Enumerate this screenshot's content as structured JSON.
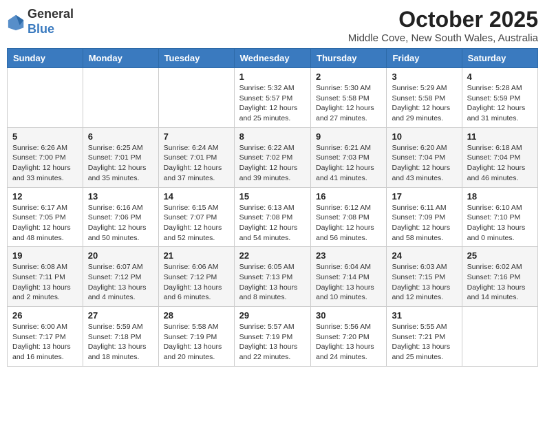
{
  "logo": {
    "general": "General",
    "blue": "Blue"
  },
  "title": "October 2025",
  "subtitle": "Middle Cove, New South Wales, Australia",
  "weekdays": [
    "Sunday",
    "Monday",
    "Tuesday",
    "Wednesday",
    "Thursday",
    "Friday",
    "Saturday"
  ],
  "weeks": [
    [
      null,
      null,
      null,
      {
        "day": 1,
        "sunrise": "5:32 AM",
        "sunset": "5:57 PM",
        "daylight": "12 hours and 25 minutes."
      },
      {
        "day": 2,
        "sunrise": "5:30 AM",
        "sunset": "5:58 PM",
        "daylight": "12 hours and 27 minutes."
      },
      {
        "day": 3,
        "sunrise": "5:29 AM",
        "sunset": "5:58 PM",
        "daylight": "12 hours and 29 minutes."
      },
      {
        "day": 4,
        "sunrise": "5:28 AM",
        "sunset": "5:59 PM",
        "daylight": "12 hours and 31 minutes."
      }
    ],
    [
      {
        "day": 5,
        "sunrise": "6:26 AM",
        "sunset": "7:00 PM",
        "daylight": "12 hours and 33 minutes."
      },
      {
        "day": 6,
        "sunrise": "6:25 AM",
        "sunset": "7:01 PM",
        "daylight": "12 hours and 35 minutes."
      },
      {
        "day": 7,
        "sunrise": "6:24 AM",
        "sunset": "7:01 PM",
        "daylight": "12 hours and 37 minutes."
      },
      {
        "day": 8,
        "sunrise": "6:22 AM",
        "sunset": "7:02 PM",
        "daylight": "12 hours and 39 minutes."
      },
      {
        "day": 9,
        "sunrise": "6:21 AM",
        "sunset": "7:03 PM",
        "daylight": "12 hours and 41 minutes."
      },
      {
        "day": 10,
        "sunrise": "6:20 AM",
        "sunset": "7:04 PM",
        "daylight": "12 hours and 43 minutes."
      },
      {
        "day": 11,
        "sunrise": "6:18 AM",
        "sunset": "7:04 PM",
        "daylight": "12 hours and 46 minutes."
      }
    ],
    [
      {
        "day": 12,
        "sunrise": "6:17 AM",
        "sunset": "7:05 PM",
        "daylight": "12 hours and 48 minutes."
      },
      {
        "day": 13,
        "sunrise": "6:16 AM",
        "sunset": "7:06 PM",
        "daylight": "12 hours and 50 minutes."
      },
      {
        "day": 14,
        "sunrise": "6:15 AM",
        "sunset": "7:07 PM",
        "daylight": "12 hours and 52 minutes."
      },
      {
        "day": 15,
        "sunrise": "6:13 AM",
        "sunset": "7:08 PM",
        "daylight": "12 hours and 54 minutes."
      },
      {
        "day": 16,
        "sunrise": "6:12 AM",
        "sunset": "7:08 PM",
        "daylight": "12 hours and 56 minutes."
      },
      {
        "day": 17,
        "sunrise": "6:11 AM",
        "sunset": "7:09 PM",
        "daylight": "12 hours and 58 minutes."
      },
      {
        "day": 18,
        "sunrise": "6:10 AM",
        "sunset": "7:10 PM",
        "daylight": "13 hours and 0 minutes."
      }
    ],
    [
      {
        "day": 19,
        "sunrise": "6:08 AM",
        "sunset": "7:11 PM",
        "daylight": "13 hours and 2 minutes."
      },
      {
        "day": 20,
        "sunrise": "6:07 AM",
        "sunset": "7:12 PM",
        "daylight": "13 hours and 4 minutes."
      },
      {
        "day": 21,
        "sunrise": "6:06 AM",
        "sunset": "7:12 PM",
        "daylight": "13 hours and 6 minutes."
      },
      {
        "day": 22,
        "sunrise": "6:05 AM",
        "sunset": "7:13 PM",
        "daylight": "13 hours and 8 minutes."
      },
      {
        "day": 23,
        "sunrise": "6:04 AM",
        "sunset": "7:14 PM",
        "daylight": "13 hours and 10 minutes."
      },
      {
        "day": 24,
        "sunrise": "6:03 AM",
        "sunset": "7:15 PM",
        "daylight": "13 hours and 12 minutes."
      },
      {
        "day": 25,
        "sunrise": "6:02 AM",
        "sunset": "7:16 PM",
        "daylight": "13 hours and 14 minutes."
      }
    ],
    [
      {
        "day": 26,
        "sunrise": "6:00 AM",
        "sunset": "7:17 PM",
        "daylight": "13 hours and 16 minutes."
      },
      {
        "day": 27,
        "sunrise": "5:59 AM",
        "sunset": "7:18 PM",
        "daylight": "13 hours and 18 minutes."
      },
      {
        "day": 28,
        "sunrise": "5:58 AM",
        "sunset": "7:19 PM",
        "daylight": "13 hours and 20 minutes."
      },
      {
        "day": 29,
        "sunrise": "5:57 AM",
        "sunset": "7:19 PM",
        "daylight": "13 hours and 22 minutes."
      },
      {
        "day": 30,
        "sunrise": "5:56 AM",
        "sunset": "7:20 PM",
        "daylight": "13 hours and 24 minutes."
      },
      {
        "day": 31,
        "sunrise": "5:55 AM",
        "sunset": "7:21 PM",
        "daylight": "13 hours and 25 minutes."
      },
      null
    ]
  ]
}
